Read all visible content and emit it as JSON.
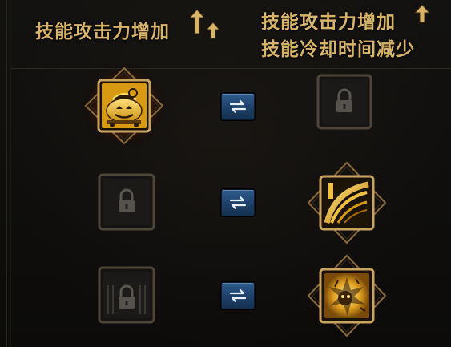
{
  "header": {
    "left_title": "技能攻击力增加",
    "right_line1": "技能攻击力增加",
    "right_line2": "技能冷却时间减少",
    "arrow_icon": "up-arrow-icon"
  },
  "rows": [
    {
      "left_slot": {
        "state": "active",
        "icon": "pumpkin-cart-icon"
      },
      "swap_icon": "swap-arrows-icon",
      "right_slot": {
        "state": "locked",
        "icon": "lock-icon"
      }
    },
    {
      "left_slot": {
        "state": "locked",
        "icon": "lock-icon"
      },
      "swap_icon": "swap-arrows-icon",
      "right_slot": {
        "state": "active",
        "icon": "sonic-slash-icon"
      }
    },
    {
      "left_slot": {
        "state": "locked",
        "icon": "lock-icon"
      },
      "swap_icon": "swap-arrows-icon",
      "right_slot": {
        "state": "active",
        "icon": "burst-creature-icon"
      }
    }
  ],
  "colors": {
    "gold": "#d8b46a",
    "swap_blue": "#2e5d8e",
    "ember": "#7a2a14"
  }
}
